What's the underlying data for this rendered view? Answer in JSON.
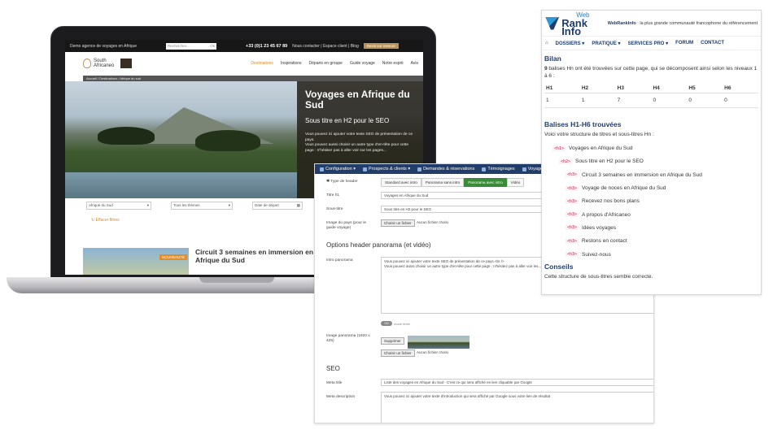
{
  "site": {
    "topbar": {
      "title": "Demo agence de voyages en Afrique",
      "search_placeholder": "Rechercher...",
      "search_button": "Ok",
      "phone": "+33 (0)1 23 45 67 89",
      "links": "Nous contacter | Espace client | Blog",
      "cta": "Devis sur mesure"
    },
    "logo": {
      "line1": "South",
      "line2": "Africaneo"
    },
    "nav": [
      "Destinations",
      "Inspirations",
      "Départs en groupe",
      "Guide voyage",
      "Notre esprit",
      "Avis"
    ],
    "breadcrumb": "Accueil  /  Destinations  /  Afrique du sud",
    "hero": {
      "title": "Voyages en Afrique du Sud",
      "subtitle": "Sous titre en H2 pour le SEO",
      "text1": "Vous pouvez ici ajouter votre texte SEO de présentation de ce pays.",
      "text2": "Vous pouvez aussi choisir un autre type d'en-tête pour cette page : n'hésitez pas à aller voir sur les pages..."
    },
    "filters": {
      "destination": "Afrique du Sud",
      "themes": "Tous les thèmes",
      "date_placeholder": "Date de départ"
    },
    "reset_filters": "Effacer filtres",
    "card": {
      "badge": "NOUVEAUTÉ",
      "title": "Circuit 3 semaines en immersion en Afrique du Sud"
    }
  },
  "admin": {
    "menu": [
      "Configuration ▾",
      "Prospects & clients ▾",
      "Demandes & réservations",
      "Témoignages",
      "Voyages"
    ],
    "header_type_label": "Type de header",
    "header_types": [
      "Standard avec intro",
      "Panorama sans intro",
      "Panorama avec intro",
      "Vidéo"
    ],
    "header_selected": "Panorama avec intro",
    "title_label": "Titre h1",
    "title_value": "Voyages en Afrique du Sud",
    "subtitle_label": "Sous-titre",
    "subtitle_value": "Sous titre en H2 pour le SEO",
    "image_label": "Image du pays (pour le guide voyage)",
    "file_button": "Choisir un fichier",
    "no_file": "Aucun fichier choisi",
    "panorama_section": "Options header panorama (et vidéo)",
    "intro_label": "Intro panorama",
    "intro_line1": "Vous pouvez ici ajouter votre texte SEO de présentation de ce pays.<br />",
    "intro_line2": "Vous pouvez aussi choisir un autre type d'en-tête pour cette page : n'hésitez pas à aller voir les...",
    "toggle_state": "ON",
    "toggle_label": "mode texte",
    "panorama_image_label": "Image panorama (1920 x 425)",
    "delete_button": "Supprimer",
    "seo_section": "SEO",
    "meta_title_label": "Meta title",
    "meta_title_value": "Liste des voyages en Afrique du Sud - C'est ce qui sera affiché en lien cliquable par Google",
    "meta_desc_label": "Meta description",
    "meta_desc_value": "Vous pouvez ici ajouter votre texte d'introduction qui sera affiché par Google sous votre lien de résultat"
  },
  "wri": {
    "logo_web": "Web",
    "logo_main": "Rank Info",
    "tagline_brand": "WebRankInfo",
    "tagline_rest": " : la plus grande communauté francophone du référencement",
    "nav": [
      "DOSSIERS ▾",
      "PRATIQUE ▾",
      "SERVICES PRO ▾",
      "FORUM",
      "CONTACT"
    ],
    "bilan_title": "Bilan",
    "bilan_count": "9",
    "bilan_text": " balises Hn ont été trouvées sur cette page, qui se décomposent ainsi selon les niveaux 1 à 6 :",
    "table_headers": [
      "H1",
      "H2",
      "H3",
      "H4",
      "H5",
      "H6"
    ],
    "table_values": [
      "1",
      "1",
      "7",
      "0",
      "0",
      "0"
    ],
    "found_title": "Balises H1-H6 trouvées",
    "found_intro": "Voici votre structure de titres et sous-titres Hn :",
    "headings": [
      {
        "tag": "<h1>",
        "text": "Voyages en Afrique du Sud"
      },
      {
        "tag": "<h2>",
        "text": "Sous titre en H2 pour le SEO"
      },
      {
        "tag": "<h3>",
        "text": "Circuit 3 semaines en immersion en Afrique du Sud"
      },
      {
        "tag": "<h3>",
        "text": "Voyage de noces en Afrique du Sud"
      },
      {
        "tag": "<h3>",
        "text": "Recevez nos bons plans"
      },
      {
        "tag": "<h3>",
        "text": "A propos d'Africaneo"
      },
      {
        "tag": "<h3>",
        "text": "Idées voyages"
      },
      {
        "tag": "<h3>",
        "text": "Restons en contact"
      },
      {
        "tag": "<h3>",
        "text": "Suivez-nous"
      }
    ],
    "advice_title": "Conseils",
    "advice_text": "Cette structure de sous-titres semble correcte."
  }
}
